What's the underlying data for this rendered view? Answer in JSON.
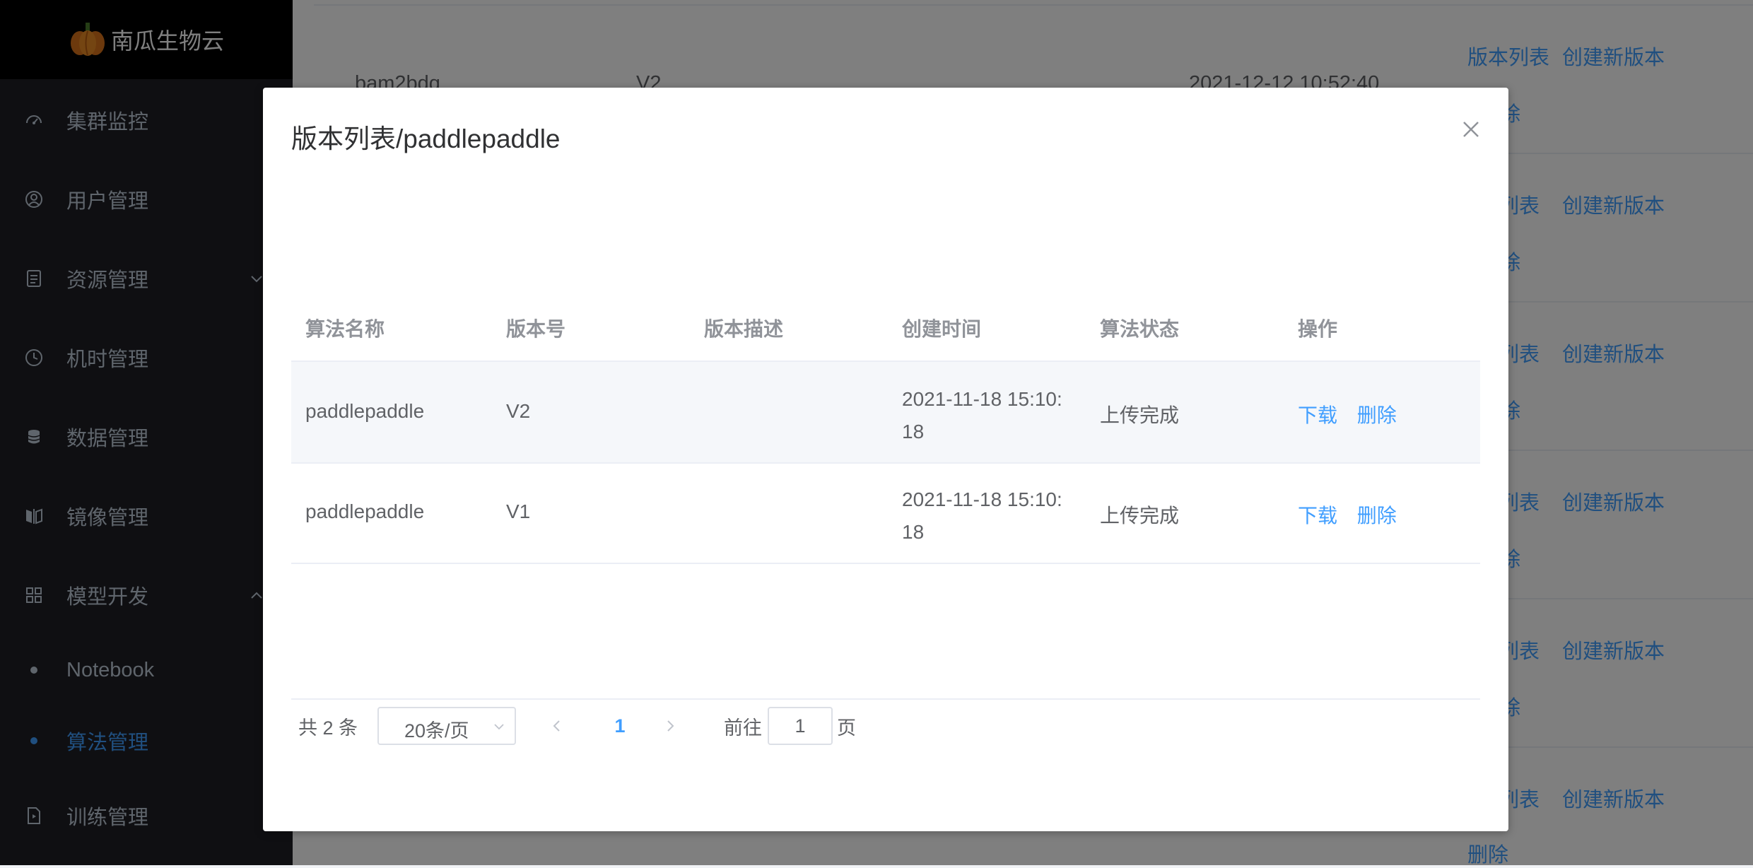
{
  "app": {
    "name": "南瓜生物云"
  },
  "sidebar": {
    "items": [
      {
        "label": "集群监控",
        "icon": "dashboard-icon"
      },
      {
        "label": "用户管理",
        "icon": "user-icon"
      },
      {
        "label": "资源管理",
        "icon": "document-icon"
      },
      {
        "label": "机时管理",
        "icon": "clock-icon"
      },
      {
        "label": "数据管理",
        "icon": "database-icon"
      },
      {
        "label": "镜像管理",
        "icon": "mirror-icon"
      },
      {
        "label": "模型开发",
        "icon": "grid-icon"
      }
    ],
    "subitems": [
      {
        "label": "Notebook"
      },
      {
        "label": "算法管理",
        "active": true
      }
    ],
    "last_item": {
      "label": "训练管理",
      "icon": "file-icon"
    }
  },
  "background": {
    "row": {
      "name": "bam2bdq",
      "version": "V2",
      "time": "2021-12-12 10:52:40"
    },
    "links": {
      "version_list": "版本列表",
      "version_list_partial": "列表",
      "create": "创建新版本",
      "delete": "删除",
      "delete_partial": "除"
    }
  },
  "dialog": {
    "title": "版本列表/paddlepaddle",
    "columns": [
      "算法名称",
      "版本号",
      "版本描述",
      "创建时间",
      "算法状态",
      "操作"
    ],
    "rows": [
      {
        "name": "paddlepaddle",
        "version": "V2",
        "desc": "",
        "time": "2021-11-18 15:10:18",
        "status": "上传完成",
        "download": "下载",
        "delete": "删除"
      },
      {
        "name": "paddlepaddle",
        "version": "V1",
        "desc": "",
        "time": "2021-11-18 15:10:18",
        "status": "上传完成",
        "download": "下载",
        "delete": "删除"
      }
    ],
    "pagination": {
      "total": "共 2 条",
      "page_size": "20条/页",
      "current": "1",
      "goto": "前往",
      "goto_value": "1",
      "page_suffix": "页"
    }
  },
  "colors": {
    "accent": "#409eff",
    "sidebar_bg": "#1f1f24",
    "logo_bg": "#000000"
  }
}
